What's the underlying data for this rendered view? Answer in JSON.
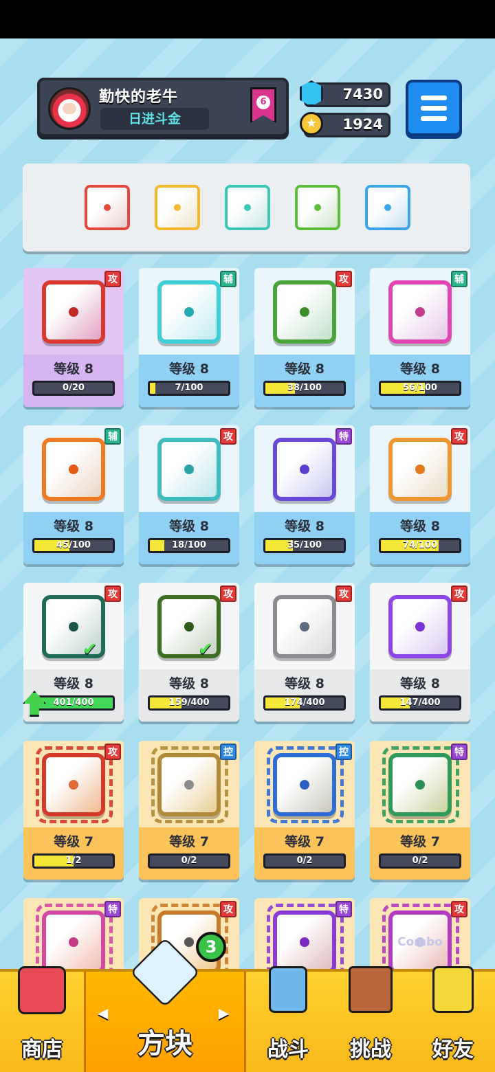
{
  "profile": {
    "name": "勤快的老牛",
    "title": "日进斗金",
    "rank": "6"
  },
  "resources": {
    "gems": "7430",
    "coins": "1924"
  },
  "equipped": [
    {
      "color": "#e3483d"
    },
    {
      "color": "#f5b72e"
    },
    {
      "color": "#3cc7b8"
    },
    {
      "color": "#5bbf3a"
    },
    {
      "color": "#3aa6e8"
    }
  ],
  "cards": [
    {
      "tag": "攻",
      "tag_type": "atk",
      "level": "等级 8",
      "progress": "0/20",
      "fill": 0,
      "theme": "purple",
      "color": "#d9382f",
      "dot": "#c12a25"
    },
    {
      "tag": "辅",
      "tag_type": "sup",
      "level": "等级 8",
      "progress": "7/100",
      "fill": 0.07,
      "theme": "blue",
      "color": "#3fcfd8",
      "dot": "#25a9b5"
    },
    {
      "tag": "攻",
      "tag_type": "atk",
      "level": "等级 8",
      "progress": "38/100",
      "fill": 0.38,
      "theme": "blue",
      "color": "#4aa43a",
      "dot": "#3a8f2b"
    },
    {
      "tag": "辅",
      "tag_type": "sup",
      "level": "等级 8",
      "progress": "56/100",
      "fill": 0.56,
      "theme": "blue",
      "color": "#e045b3",
      "dot": "#c13b8f"
    },
    {
      "tag": "辅",
      "tag_type": "sup",
      "level": "等级 8",
      "progress": "45/100",
      "fill": 0.45,
      "theme": "blue",
      "color": "#f07a22",
      "dot": "#e45b14"
    },
    {
      "tag": "攻",
      "tag_type": "atk",
      "level": "等级 8",
      "progress": "18/100",
      "fill": 0.18,
      "theme": "blue",
      "color": "#3fbcc0",
      "dot": "#2aa3a8"
    },
    {
      "tag": "特",
      "tag_type": "spc",
      "level": "等级 8",
      "progress": "35/100",
      "fill": 0.35,
      "theme": "blue",
      "color": "#6a48d8",
      "dot": "#5a3fd0"
    },
    {
      "tag": "攻",
      "tag_type": "atk",
      "level": "等级 8",
      "progress": "74/100",
      "fill": 0.74,
      "theme": "blue",
      "color": "#f0962f",
      "dot": "#e07a1c"
    },
    {
      "tag": "攻",
      "tag_type": "atk",
      "level": "等级 8",
      "progress": "401/400",
      "fill": 1,
      "theme": "gray",
      "color": "#1f6b58",
      "dot": "#19584a",
      "check": "✔",
      "fill_color": "green"
    },
    {
      "tag": "攻",
      "tag_type": "atk",
      "level": "等级 8",
      "progress": "159/400",
      "fill": 0.4,
      "theme": "gray",
      "color": "#3c6e22",
      "dot": "#2f5a1a",
      "check": "✔"
    },
    {
      "tag": "攻",
      "tag_type": "atk",
      "level": "等级 8",
      "progress": "174/400",
      "fill": 0.44,
      "theme": "gray",
      "color": "#8a8c92",
      "dot": "#5d6a80"
    },
    {
      "tag": "攻",
      "tag_type": "atk",
      "level": "等级 8",
      "progress": "147/400",
      "fill": 0.37,
      "theme": "gray",
      "color": "#8f46e6",
      "dot": "#7a34d4"
    },
    {
      "tag": "攻",
      "tag_type": "atk",
      "level": "等级 7",
      "progress": "1/2",
      "fill": 0.5,
      "theme": "orange",
      "color": "#d43a2a",
      "dot": "#e06a3a",
      "dragon": true
    },
    {
      "tag": "控",
      "tag_type": "ctl",
      "level": "等级 7",
      "progress": "0/2",
      "fill": 0,
      "theme": "orange",
      "color": "#b08a3a",
      "dot": "#8c8c8c",
      "dragon": true
    },
    {
      "tag": "控",
      "tag_type": "ctl",
      "level": "等级 7",
      "progress": "0/2",
      "fill": 0,
      "theme": "orange",
      "color": "#2e6cd6",
      "dot": "#2a5fc0",
      "dragon": true
    },
    {
      "tag": "特",
      "tag_type": "spc",
      "level": "等级 7",
      "progress": "0/2",
      "fill": 0,
      "theme": "orange",
      "color": "#2f9a5a",
      "dot": "#2a8f52",
      "dragon": true
    },
    {
      "tag": "特",
      "tag_type": "spc",
      "theme": "orange",
      "color": "#d44aa2",
      "dot": "#c43a86",
      "dragon": true,
      "partial": true
    },
    {
      "tag": "攻",
      "tag_type": "atk",
      "theme": "orange",
      "color": "#c87a2a",
      "dot": "#555",
      "dragon": true,
      "partial": true
    },
    {
      "tag": "特",
      "tag_type": "spc",
      "theme": "orange",
      "color": "#8a3ad6",
      "dot": "#7a2ac0",
      "dragon": true,
      "partial": true
    },
    {
      "tag": "攻",
      "tag_type": "atk",
      "theme": "orange",
      "color": "#b43ac0",
      "dot": "#c0c0e0",
      "dragon": true,
      "partial": true,
      "text": "Combo"
    }
  ],
  "nav": {
    "shop": "商店",
    "blocks": "方块",
    "battle": "战斗",
    "challenge": "挑战",
    "friends": "好友",
    "badge": "3"
  },
  "themes": {
    "purple": {
      "top": "#e3c6f3",
      "bottom": "#d7b3ef"
    },
    "blue": {
      "top": "#e9f4fb",
      "bottom": "#8fd0f3"
    },
    "gray": {
      "top": "#f4f5f6",
      "bottom": "#e6e8ea"
    },
    "orange": {
      "top": "#fde6b6",
      "bottom": "#fcc35a"
    }
  }
}
